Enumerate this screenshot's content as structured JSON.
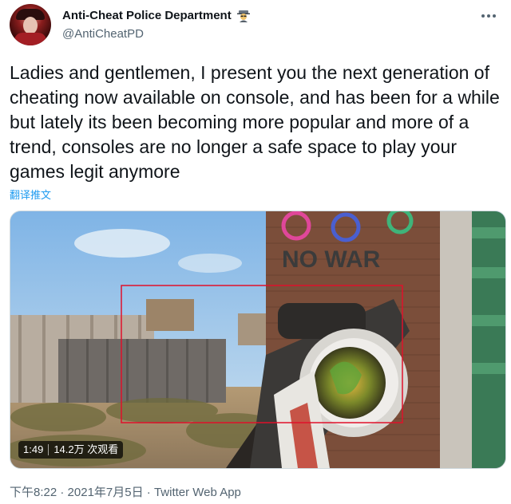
{
  "header": {
    "display_name": "Anti-Cheat Police Department",
    "handle": "@AntiCheatPD",
    "badge_icon": "detective-icon",
    "more_icon": "more-dots-icon"
  },
  "tweet": {
    "text": "Ladies and gentlemen, I present you the next generation of cheating now available on console, and has been for a while but lately its been becoming more popular and more of a trend, consoles are no longer a safe space to play your games legit anymore",
    "translate_label": "翻译推文"
  },
  "media": {
    "duration": "1:49",
    "views": "14.2万 次观看",
    "wall_text": "NO WAR",
    "highlight_color": "#e0102a"
  },
  "meta": {
    "time": "下午8:22",
    "date": "2021年7月5日",
    "source": "Twitter Web App",
    "separator": " · "
  }
}
